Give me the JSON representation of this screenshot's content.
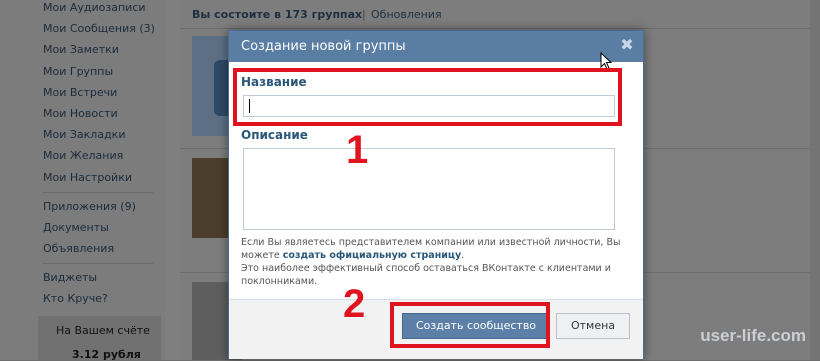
{
  "left_menu": {
    "items": [
      "Мои Аудиозаписи",
      "Мои Сообщения (3)",
      "Мои Заметки",
      "Мои Группы",
      "Мои Встречи",
      "Мои Новости",
      "Мои Закладки",
      "Мои Желания",
      "Мои Настройки"
    ],
    "items2": [
      "Приложения (9)",
      "Документы",
      "Объявления"
    ],
    "items3": [
      "Виджеты",
      "Кто Круче?"
    ],
    "balance_label": "На Вашем счёте",
    "balance_value": "3.12 рубля"
  },
  "content": {
    "groups_count": "Вы состоите в 173 группах",
    "separator": "|",
    "updates": "Обновления"
  },
  "dialog": {
    "title": "Создание новой группы",
    "close": "✖",
    "name_label": "Название",
    "name_value": "",
    "description_label": "Описание",
    "description_value": "",
    "hint_part1": "Если Вы являетесь представителем компании или известной личности, Вы можете ",
    "hint_link": "создать официальную страницу",
    "hint_part2": ".",
    "hint_line2": "Это наиболее эффективный способ оставаться ВКонтакте с клиентами и поклонниками.",
    "create_button": "Создать сообщество",
    "cancel_button": "Отмена"
  },
  "annotations": {
    "number1": "1",
    "number2": "2",
    "color": "#e0141e"
  },
  "watermark": "user-life.com",
  "colors": {
    "header_blue": "#597da3",
    "primary_button": "#5b7fa6",
    "link": "#2b587a"
  }
}
